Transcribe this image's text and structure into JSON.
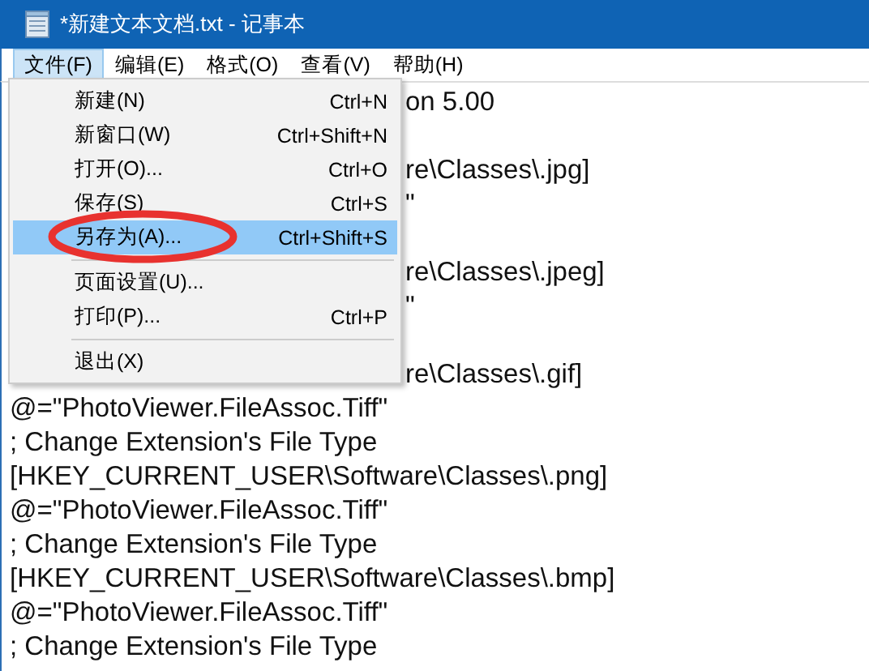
{
  "window": {
    "title": "*新建文本文档.txt - 记事本"
  },
  "menu_bar": [
    {
      "label": "文件(F)",
      "selected": true
    },
    {
      "label": "编辑(E)",
      "selected": false
    },
    {
      "label": "格式(O)",
      "selected": false
    },
    {
      "label": "查看(V)",
      "selected": false
    },
    {
      "label": "帮助(H)",
      "selected": false
    }
  ],
  "file_menu": [
    {
      "kind": "item",
      "label": "新建(N)",
      "shortcut": "Ctrl+N",
      "selected": false,
      "circled": false
    },
    {
      "kind": "item",
      "label": "新窗口(W)",
      "shortcut": "Ctrl+Shift+N",
      "selected": false,
      "circled": false
    },
    {
      "kind": "item",
      "label": "打开(O)...",
      "shortcut": "Ctrl+O",
      "selected": false,
      "circled": false
    },
    {
      "kind": "item",
      "label": "保存(S)",
      "shortcut": "Ctrl+S",
      "selected": false,
      "circled": false
    },
    {
      "kind": "item",
      "label": "另存为(A)...",
      "shortcut": "Ctrl+Shift+S",
      "selected": true,
      "circled": true
    },
    {
      "kind": "separator"
    },
    {
      "kind": "item",
      "label": "页面设置(U)...",
      "selected": false,
      "circled": false
    },
    {
      "kind": "item",
      "label": "打印(P)...",
      "shortcut": "Ctrl+P",
      "selected": false,
      "circled": false
    },
    {
      "kind": "separator"
    },
    {
      "kind": "item",
      "label": "退出(X)",
      "selected": false,
      "circled": false
    }
  ],
  "editor_lines": [
    {
      "kind": "clipped",
      "text": "on 5.00"
    },
    {
      "kind": "hidden"
    },
    {
      "kind": "clipped",
      "text": "re\\Classes\\.jpg]"
    },
    {
      "kind": "clipped",
      "text": "\""
    },
    {
      "kind": "hidden"
    },
    {
      "kind": "clipped",
      "text": "re\\Classes\\.jpeg]"
    },
    {
      "kind": "clipped",
      "text": "\""
    },
    {
      "kind": "hidden"
    },
    {
      "kind": "clipped",
      "text": "re\\Classes\\.gif]"
    },
    {
      "kind": "full",
      "text": "@=\"PhotoViewer.FileAssoc.Tiff\""
    },
    {
      "kind": "full",
      "text": "; Change Extension's File Type"
    },
    {
      "kind": "full",
      "text": "[HKEY_CURRENT_USER\\Software\\Classes\\.png]"
    },
    {
      "kind": "full",
      "text": "@=\"PhotoViewer.FileAssoc.Tiff\""
    },
    {
      "kind": "full",
      "text": "; Change Extension's File Type"
    },
    {
      "kind": "full",
      "text": "[HKEY_CURRENT_USER\\Software\\Classes\\.bmp]"
    },
    {
      "kind": "full",
      "text": "@=\"PhotoViewer.FileAssoc.Tiff\""
    },
    {
      "kind": "full",
      "text": "; Change Extension's File Type"
    }
  ]
}
